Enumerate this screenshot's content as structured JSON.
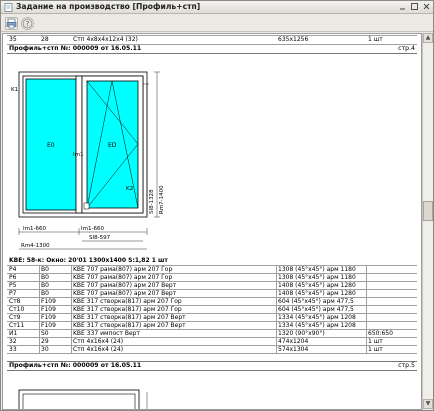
{
  "window": {
    "title": "Задание на производство [Профиль+стп]"
  },
  "top_row": [
    "35",
    "28",
    "Стп 4х8х4х12х4 (32)",
    "635х1256",
    "1 шт"
  ],
  "page1": {
    "header": "Профиль+стп №: 000009 от 16.05.11",
    "page_label": "стр.4"
  },
  "drawing": {
    "sash_left_label": "E0",
    "sash_right_label": "ED",
    "k1": "K1",
    "k2": "K2",
    "im1": "Im1",
    "dim_height_1": "SI8-1328",
    "dim_height_2": "Rm7-1400",
    "dim_w_left": "Im1-660",
    "dim_w_right": "Im1-660",
    "dim_w_sash": "SI8-597",
    "dim_total": "Rm4-1300"
  },
  "section": {
    "title": "KBE: 58-к: Окно: 20'01 1300х1400 S:1,82  1 шт"
  },
  "table": [
    [
      "P4",
      "B0",
      "KBE 707 рама(807)  арм 207 Гор",
      "1308 (45°x45°)  арм 1180",
      ""
    ],
    [
      "P6",
      "B0",
      "KBE 707 рама(807)  арм 207 Гор",
      "1308 (45°x45°)  арм 1180",
      ""
    ],
    [
      "P5",
      "B0",
      "KBE 707 рама(807)  арм 207 Верт",
      "1408 (45°x45°)  арм 1280",
      ""
    ],
    [
      "P7",
      "B0",
      "KBE 707 рама(807)  арм 207 Верт",
      "1408 (45°x45°)  арм 1280",
      ""
    ],
    [
      "Ст8",
      "F109",
      "KBE 317 створка(817)  арм 207 Гор",
      "604 (45°x45°)  арм 477,5",
      ""
    ],
    [
      "Ст10",
      "F109",
      "KBE 317 створка(817)  арм 207 Гор",
      "604 (45°x45°)  арм 477,5",
      ""
    ],
    [
      "Ст9",
      "F109",
      "KBE 317 створка(817)  арм 207 Верт",
      "1334 (45°x45°)  арм 1208",
      ""
    ],
    [
      "Ст11",
      "F109",
      "KBE 317 створка(817)  арм 207 Верт",
      "1334 (45°x45°)  арм 1208",
      ""
    ],
    [
      "И1",
      "S0",
      "KBE 337 импост Верт",
      "1320 (90°x90°)",
      "650:650"
    ],
    [
      "32",
      "29",
      "Стп 4х16х4 (24)",
      "474х1204",
      "1 шт"
    ],
    [
      "33",
      "30",
      "Стп 4х16х4 (24)",
      "574х1304",
      "1 шт"
    ]
  ],
  "page2": {
    "header": "Профиль+стп №: 000009 от 16.05.11",
    "page_label": "стр.5"
  }
}
